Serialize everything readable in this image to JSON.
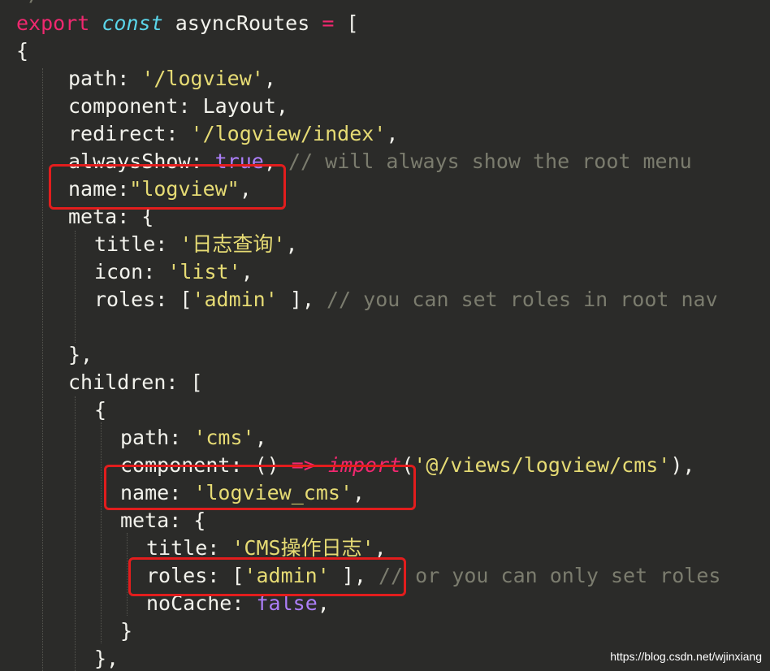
{
  "code": {
    "top_fragment": "*/",
    "l1": {
      "kw": "export",
      "kwi": "const",
      "ident": "asyncRoutes",
      "op": "=",
      "open": "["
    },
    "l2": "{",
    "l3": {
      "key": "path:",
      "val": "'/logview'",
      "tail": ","
    },
    "l4": {
      "key": "component:",
      "val": "Layout,"
    },
    "l5": {
      "key": "redirect:",
      "val": "'/logview/index'",
      "tail": ","
    },
    "l6": {
      "key": "alwaysShow:",
      "val": "true",
      "tail": ",",
      "comment": "// will always show the root menu"
    },
    "l7": {
      "key": "name:",
      "val": "\"logview\"",
      "tail": ","
    },
    "l8": "meta: {",
    "l9": {
      "key": "title:",
      "val": "'日志查询'",
      "tail": ","
    },
    "l10": {
      "key": "icon:",
      "val": "'list'",
      "tail": ","
    },
    "l11": {
      "key": "roles: [",
      "val": "'admin'",
      "tail": " ],",
      "comment": "// you can set roles in root nav"
    },
    "l13": "},",
    "l14": "children: [",
    "l15": "{",
    "l16": {
      "key": "path:",
      "val": "'cms'",
      "tail": ","
    },
    "l17": {
      "key": "component:",
      "mid": "() ",
      "arrow": "=>",
      "imp": "import",
      "open": "(",
      "val": "'@/views/logview/cms'",
      "tail": "),"
    },
    "l18": {
      "key": "name:",
      "val": "'logview_cms'",
      "tail": ","
    },
    "l19": "meta: {",
    "l20": {
      "key": "title:",
      "val": "'CMS操作日志'",
      "tail": ","
    },
    "l21": {
      "key": "roles: [",
      "val": "'admin'",
      "tail": " ],",
      "comment": "// or you can only set roles"
    },
    "l22": {
      "key": "noCache:",
      "val": "false",
      "tail": ","
    },
    "l23": "}",
    "l24": "},"
  },
  "watermark": "https://blog.csdn.net/wjinxiang",
  "colors": {
    "background": "#2b2b29",
    "keyword": "#f0286f",
    "storage": "#5bd6ea",
    "string": "#e6db74",
    "comment": "#7b7c6e",
    "boolean": "#ad7ffa",
    "highlight_box": "#e21d1d"
  }
}
